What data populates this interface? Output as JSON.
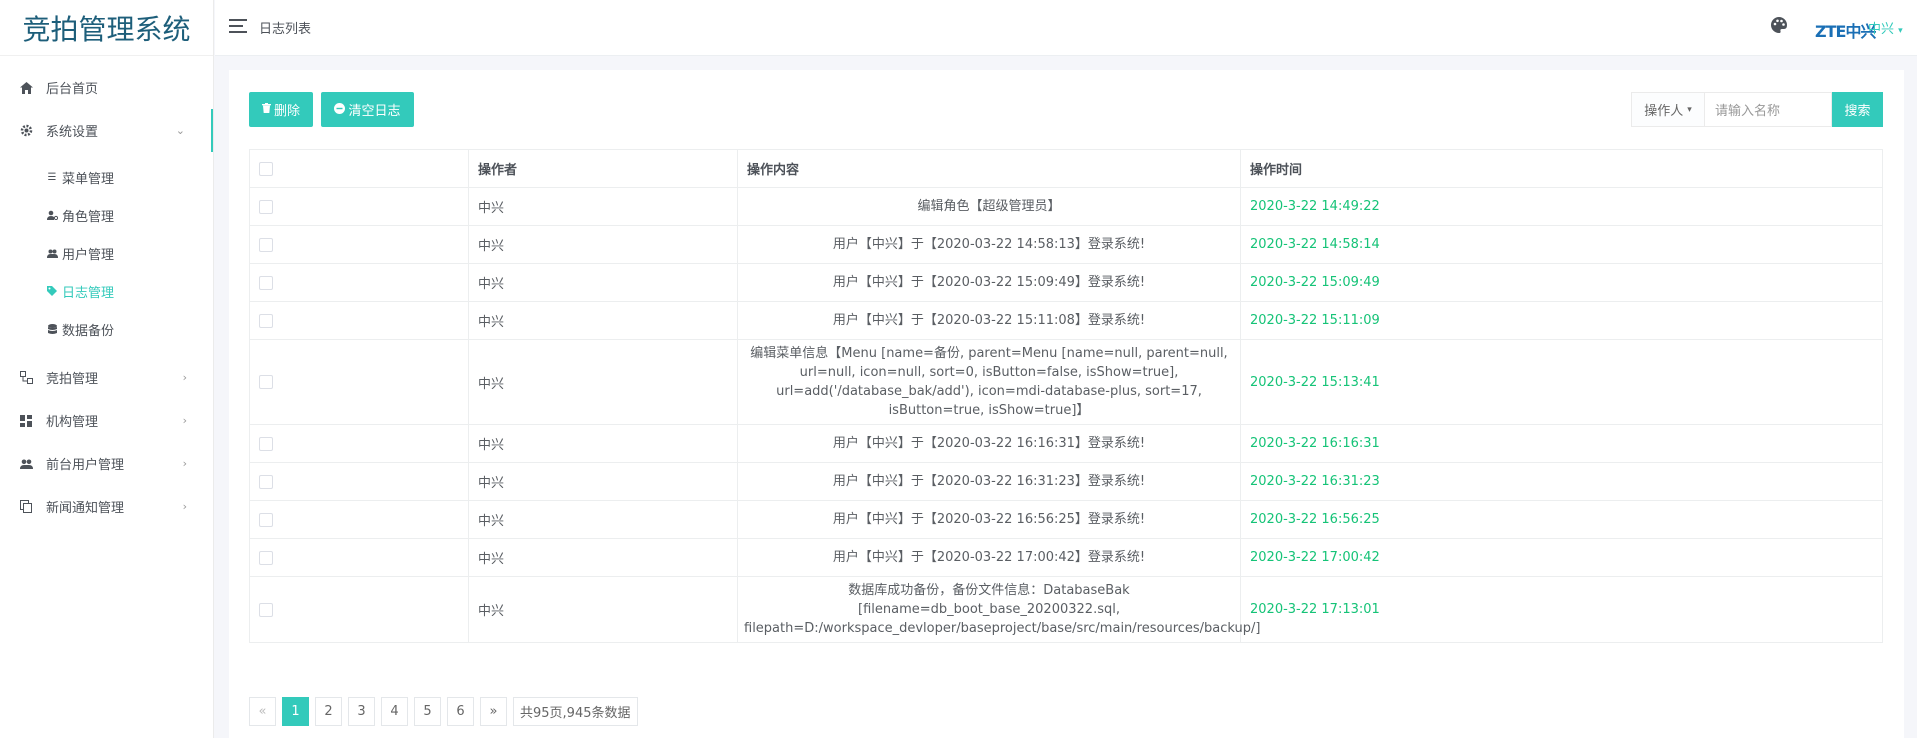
{
  "app_title": "竞拍管理系统",
  "breadcrumb": "日志列表",
  "user_name": "中兴",
  "brand_logo_text": "ZTE中兴",
  "accent_color": "#33cabb",
  "sidebar": {
    "items": [
      {
        "label": "后台首页",
        "icon": "home-icon"
      },
      {
        "label": "系统设置",
        "icon": "gear-icon",
        "submenu": [
          {
            "label": "菜单管理",
            "icon": "list-icon"
          },
          {
            "label": "角色管理",
            "icon": "user-settings-icon"
          },
          {
            "label": "用户管理",
            "icon": "users-icon"
          },
          {
            "label": "日志管理",
            "icon": "tag-icon",
            "active": true
          },
          {
            "label": "数据备份",
            "icon": "database-icon"
          }
        ]
      },
      {
        "label": "竞拍管理",
        "icon": "sitemap-icon"
      },
      {
        "label": "机构管理",
        "icon": "grid-icon"
      },
      {
        "label": "前台用户管理",
        "icon": "people-icon"
      },
      {
        "label": "新闻通知管理",
        "icon": "copy-icon"
      }
    ]
  },
  "toolbar": {
    "delete_label": "删除",
    "clear_label": "清空日志"
  },
  "search": {
    "select_label": "操作人",
    "placeholder": "请输入名称",
    "button_label": "搜索"
  },
  "table": {
    "columns": [
      "",
      "操作者",
      "操作内容",
      "操作时间"
    ],
    "rows": [
      {
        "operator": "中兴",
        "content": "编辑角色【超级管理员】",
        "time": "2020-3-22 14:49:22"
      },
      {
        "operator": "中兴",
        "content": "用户【中兴】于【2020-03-22 14:58:13】登录系统!",
        "time": "2020-3-22 14:58:14"
      },
      {
        "operator": "中兴",
        "content": "用户【中兴】于【2020-03-22 15:09:49】登录系统!",
        "time": "2020-3-22 15:09:49"
      },
      {
        "operator": "中兴",
        "content": "用户【中兴】于【2020-03-22 15:11:08】登录系统!",
        "time": "2020-3-22 15:11:09"
      },
      {
        "operator": "中兴",
        "content": "编辑菜单信息【Menu [name=备份, parent=Menu [name=null, parent=null, url=null, icon=null, sort=0, isButton=false, isShow=true], url=add('/database_bak/add'), icon=mdi-database-plus, sort=17, isButton=true, isShow=true]】",
        "time": "2020-3-22 15:13:41"
      },
      {
        "operator": "中兴",
        "content": "用户【中兴】于【2020-03-22 16:16:31】登录系统!",
        "time": "2020-3-22 16:16:31"
      },
      {
        "operator": "中兴",
        "content": "用户【中兴】于【2020-03-22 16:31:23】登录系统!",
        "time": "2020-3-22 16:31:23"
      },
      {
        "operator": "中兴",
        "content": "用户【中兴】于【2020-03-22 16:56:25】登录系统!",
        "time": "2020-3-22 16:56:25"
      },
      {
        "operator": "中兴",
        "content": "用户【中兴】于【2020-03-22 17:00:42】登录系统!",
        "time": "2020-3-22 17:00:42"
      },
      {
        "operator": "中兴",
        "content": "数据库成功备份，备份文件信息：DatabaseBak [filename=db_boot_base_20200322.sql, filepath=D:/workspace_devloper/baseproject/base/src/main/resources/backup/]",
        "time": "2020-3-22 17:13:01"
      }
    ]
  },
  "pagination": {
    "prev": "«",
    "pages": [
      "1",
      "2",
      "3",
      "4",
      "5",
      "6"
    ],
    "current": 1,
    "next": "»",
    "summary": "共95页,945条数据"
  }
}
